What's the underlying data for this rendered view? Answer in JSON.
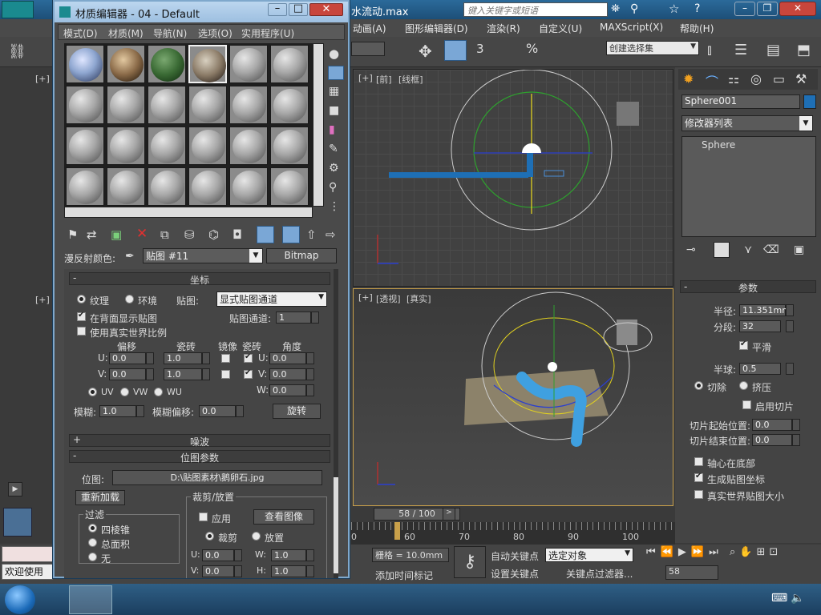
{
  "app": {
    "title_partial": "水流动.max",
    "search_placeholder": "键入关键字或短语"
  },
  "main_menu": [
    "动画(A)",
    "图形编辑器(D)",
    "渲染(R)",
    "自定义(U)",
    "MAXScript(X)",
    "帮助(H)"
  ],
  "toolbar": {
    "selection_set": "创建选择集",
    "percent_label": "%",
    "angle_label": "3"
  },
  "viewports": {
    "top_left_label": "[+]",
    "front": {
      "label_plus": "[+]",
      "label_view": "[前]",
      "label_shade": "[线框]",
      "axis_x": "x",
      "axis_y": "y",
      "axis_z": "z"
    },
    "bottom_left_label": "[+]",
    "persp": {
      "label_plus": "[+]",
      "label_view": "[透视]",
      "label_shade": "[真实]"
    }
  },
  "command_panel": {
    "object_name": "Sphere001",
    "modifier_list": "修改器列表",
    "stack_item": "Sphere",
    "params_title": "参数",
    "radius_label": "半径:",
    "radius": "11.351mm",
    "segments_label": "分段:",
    "segments": "32",
    "smooth_label": "平滑",
    "hemisphere_label": "半球:",
    "hemisphere": "0.5",
    "chop_label": "切除",
    "squash_label": "挤压",
    "slice_on_label": "启用切片",
    "slice_from_label": "切片起始位置:",
    "slice_from": "0.0",
    "slice_to_label": "切片结束位置:",
    "slice_to": "0.0",
    "base_pivot_label": "轴心在底部",
    "gen_map_label": "生成贴图坐标",
    "real_world_label": "真实世界贴图大小"
  },
  "timeline": {
    "frame_display": "58 / 100",
    "ticks": [
      "0",
      "60",
      "70",
      "80",
      "90",
      "100"
    ],
    "current_frame": 58
  },
  "status": {
    "welcome": "欢迎使用",
    "grid": "栅格 = 10.0mm",
    "add_time_tag": "添加时间标记",
    "auto_key": "自动关键点",
    "set_key": "设置关键点",
    "selected_object": "选定对象",
    "key_filters": "关键点过滤器...",
    "frame": "58"
  },
  "material_editor": {
    "title": "材质编辑器 - 04 - Default",
    "menu": [
      "模式(D)",
      "材质(M)",
      "导航(N)",
      "选项(O)",
      "实用程序(U)"
    ],
    "diffuse_label": "漫反射颜色:",
    "map_name": "贴图 #11",
    "map_type": "Bitmap",
    "coords": {
      "title": "坐标",
      "texture": "纹理",
      "environ": "环境",
      "mapping_label": "贴图:",
      "mapping": "显式贴图通道",
      "show_back": "在背面显示贴图",
      "channel_label": "贴图通道:",
      "channel": "1",
      "real_world": "使用真实世界比例",
      "offset": "偏移",
      "tiling": "瓷砖",
      "mirror": "镜像",
      "tile": "瓷砖",
      "angle": "角度",
      "u": "U:",
      "v": "V:",
      "w": "W:",
      "u_offset": "0.0",
      "v_offset": "0.0",
      "u_tiling": "1.0",
      "v_tiling": "1.0",
      "u_angle": "0.0",
      "v_angle": "0.0",
      "w_angle": "0.0",
      "uv": "UV",
      "vw": "VW",
      "wu": "WU",
      "blur_label": "模糊:",
      "blur": "1.0",
      "blur_offset_label": "模糊偏移:",
      "blur_offset": "0.0",
      "rotate": "旋转"
    },
    "noise_title": "噪波",
    "bitmap_params": {
      "title": "位图参数",
      "bitmap_label": "位图:",
      "bitmap_path": "D:\\贴图素材\\鹅卵石.jpg",
      "reload": "重新加载",
      "crop_title": "裁剪/放置",
      "apply": "应用",
      "view_image": "查看图像",
      "crop": "裁剪",
      "place": "放置",
      "filter_title": "过滤",
      "pyramidal": "四棱锥",
      "summed": "总面积",
      "none": "无",
      "u_label": "U:",
      "v_label": "V:",
      "w_label": "W:",
      "h_label": "H:",
      "u": "0.0",
      "v": "0.0",
      "w": "1.0",
      "h": "1.0"
    }
  },
  "colors": {
    "object_color": "#1e6fb5",
    "accent": "#4a90d9"
  }
}
